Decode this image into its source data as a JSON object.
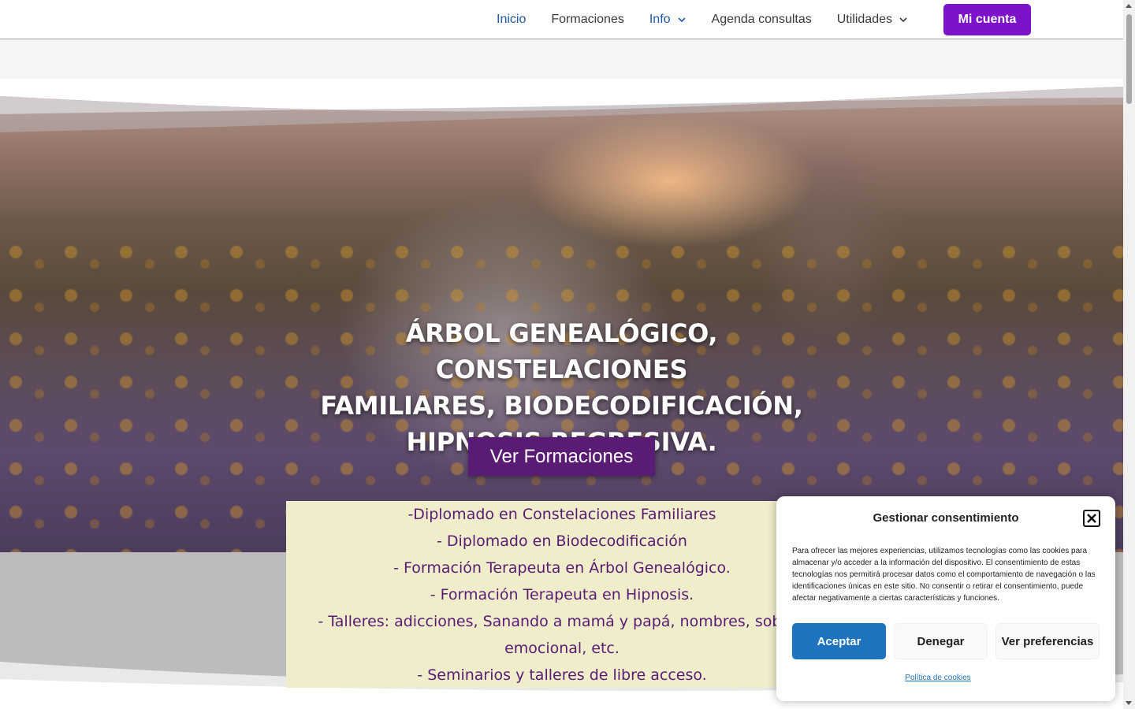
{
  "nav": {
    "items": [
      {
        "label": "Inicio",
        "state": "active"
      },
      {
        "label": "Formaciones"
      },
      {
        "label": "Info",
        "dropdown": true
      },
      {
        "label": "Agenda consultas"
      },
      {
        "label": "Utilidades",
        "dropdown": true
      }
    ],
    "account_label": "Mi cuenta"
  },
  "hero": {
    "title_lines": [
      "ÁRBOL GENEALÓGICO, CONSTELACIONES",
      "FAMILIARES, BIODECODIFICACIÓN,",
      "HIPNOSIS REGRESIVA."
    ],
    "button_label": "Ver Formaciones"
  },
  "courses": [
    "-Diplomado en Constelaciones Familiares",
    "- Diplomado en Biodecodificación",
    "- Formación Terapeuta en Árbol Genealógico.",
    "- Formación Terapeuta en Hipnosis.",
    "- Talleres: adicciones, Sanando a mamá y papá, nombres, sobrep",
    "emocional, etc.",
    "- Seminarios y talleres de libre acceso."
  ],
  "cookie": {
    "title": "Gestionar consentimiento",
    "text": "Para ofrecer las mejores experiencias, utilizamos tecnologías como las cookies para almacenar y/o acceder a la información del dispositivo. El consentimiento de estas tecnologías nos permitirá procesar datos como el comportamiento de navegación o las identificaciones únicas en este sitio. No consentir o retirar el consentimiento, puede afectar negativamente a ciertas características y funciones.",
    "accept_label": "Aceptar",
    "deny_label": "Denegar",
    "prefs_label": "Ver preferencias",
    "policy_link": "Política de cookies"
  },
  "colors": {
    "accent_purple": "#7c12c9",
    "button_purple": "#5a1b74",
    "nav_active": "#1e5aa8",
    "cookie_blue": "#1e73be",
    "course_box_bg": "#efedca"
  }
}
